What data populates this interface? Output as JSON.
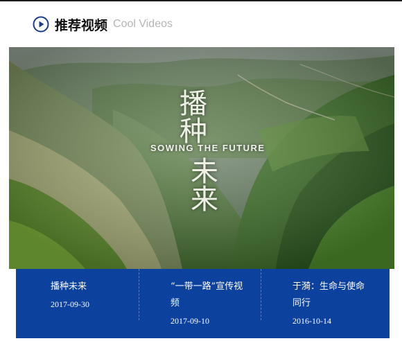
{
  "section": {
    "title": "推荐视频",
    "subtitle": "Cool Videos",
    "icon": "play-circle-icon"
  },
  "hero": {
    "title_cn_line1": "播种",
    "title_cn_line2": "未来",
    "title_en": "SOWING THE FUTURE"
  },
  "videos": [
    {
      "title": "播种未来",
      "date": "2017-09-30"
    },
    {
      "title": "“一带一路”宣传视频",
      "date": "2017-09-10"
    },
    {
      "title": "于漪：生命与使命同行",
      "date": "2016-10-14"
    }
  ],
  "colors": {
    "accent_blue": "#0d419e",
    "icon_blue": "#1a3c8a",
    "subtitle_gray": "#b5b5b5"
  }
}
